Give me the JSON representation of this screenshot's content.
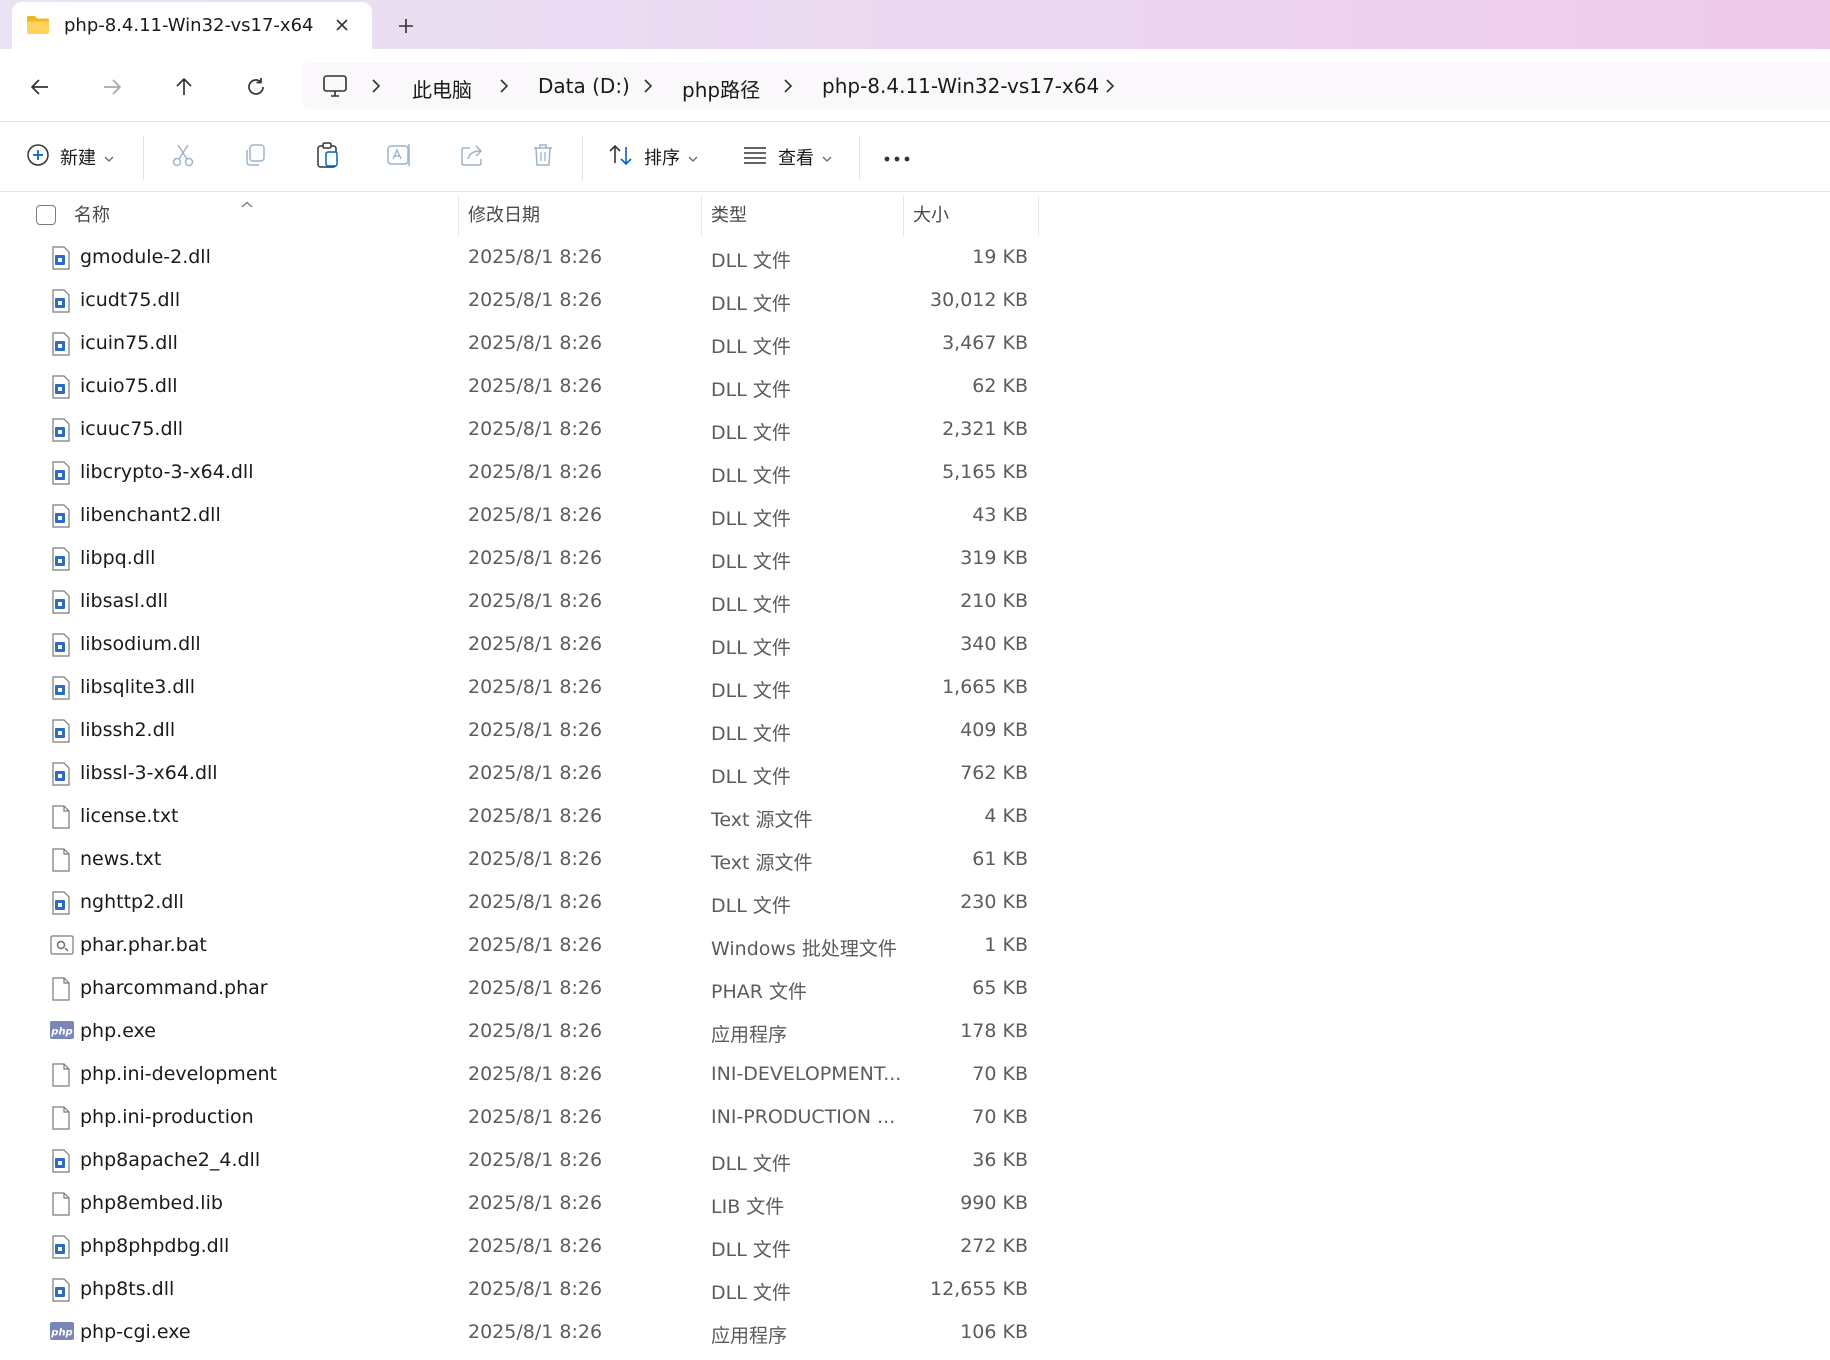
{
  "tab": {
    "title": "php-8.4.11-Win32-vs17-x64",
    "close_icon": "close-icon",
    "new_tab_icon": "plus-icon"
  },
  "nav": {
    "back_icon": "arrow-left-icon",
    "forward_icon": "arrow-right-icon",
    "up_icon": "arrow-up-icon",
    "refresh_icon": "refresh-icon"
  },
  "breadcrumbs": [
    "此电脑",
    "Data (D:)",
    "php路径",
    "php-8.4.11-Win32-vs17-x64"
  ],
  "toolbar": {
    "new_label": "新建",
    "sort_label": "排序",
    "view_label": "查看"
  },
  "columns": {
    "name": "名称",
    "date": "修改日期",
    "type": "类型",
    "size": "大小"
  },
  "files": [
    {
      "name": "gmodule-2.dll",
      "date": "2025/8/1 8:26",
      "type": "DLL 文件",
      "size": "19 KB",
      "icon": "dll"
    },
    {
      "name": "icudt75.dll",
      "date": "2025/8/1 8:26",
      "type": "DLL 文件",
      "size": "30,012 KB",
      "icon": "dll"
    },
    {
      "name": "icuin75.dll",
      "date": "2025/8/1 8:26",
      "type": "DLL 文件",
      "size": "3,467 KB",
      "icon": "dll"
    },
    {
      "name": "icuio75.dll",
      "date": "2025/8/1 8:26",
      "type": "DLL 文件",
      "size": "62 KB",
      "icon": "dll"
    },
    {
      "name": "icuuc75.dll",
      "date": "2025/8/1 8:26",
      "type": "DLL 文件",
      "size": "2,321 KB",
      "icon": "dll"
    },
    {
      "name": "libcrypto-3-x64.dll",
      "date": "2025/8/1 8:26",
      "type": "DLL 文件",
      "size": "5,165 KB",
      "icon": "dll"
    },
    {
      "name": "libenchant2.dll",
      "date": "2025/8/1 8:26",
      "type": "DLL 文件",
      "size": "43 KB",
      "icon": "dll"
    },
    {
      "name": "libpq.dll",
      "date": "2025/8/1 8:26",
      "type": "DLL 文件",
      "size": "319 KB",
      "icon": "dll"
    },
    {
      "name": "libsasl.dll",
      "date": "2025/8/1 8:26",
      "type": "DLL 文件",
      "size": "210 KB",
      "icon": "dll"
    },
    {
      "name": "libsodium.dll",
      "date": "2025/8/1 8:26",
      "type": "DLL 文件",
      "size": "340 KB",
      "icon": "dll"
    },
    {
      "name": "libsqlite3.dll",
      "date": "2025/8/1 8:26",
      "type": "DLL 文件",
      "size": "1,665 KB",
      "icon": "dll"
    },
    {
      "name": "libssh2.dll",
      "date": "2025/8/1 8:26",
      "type": "DLL 文件",
      "size": "409 KB",
      "icon": "dll"
    },
    {
      "name": "libssl-3-x64.dll",
      "date": "2025/8/1 8:26",
      "type": "DLL 文件",
      "size": "762 KB",
      "icon": "dll"
    },
    {
      "name": "license.txt",
      "date": "2025/8/1 8:26",
      "type": "Text 源文件",
      "size": "4 KB",
      "icon": "doc"
    },
    {
      "name": "news.txt",
      "date": "2025/8/1 8:26",
      "type": "Text 源文件",
      "size": "61 KB",
      "icon": "doc"
    },
    {
      "name": "nghttp2.dll",
      "date": "2025/8/1 8:26",
      "type": "DLL 文件",
      "size": "230 KB",
      "icon": "dll"
    },
    {
      "name": "phar.phar.bat",
      "date": "2025/8/1 8:26",
      "type": "Windows 批处理文件",
      "size": "1 KB",
      "icon": "bat"
    },
    {
      "name": "pharcommand.phar",
      "date": "2025/8/1 8:26",
      "type": "PHAR 文件",
      "size": "65 KB",
      "icon": "doc"
    },
    {
      "name": "php.exe",
      "date": "2025/8/1 8:26",
      "type": "应用程序",
      "size": "178 KB",
      "icon": "php"
    },
    {
      "name": "php.ini-development",
      "date": "2025/8/1 8:26",
      "type": "INI-DEVELOPMENT...",
      "size": "70 KB",
      "icon": "doc"
    },
    {
      "name": "php.ini-production",
      "date": "2025/8/1 8:26",
      "type": "INI-PRODUCTION ...",
      "size": "70 KB",
      "icon": "doc"
    },
    {
      "name": "php8apache2_4.dll",
      "date": "2025/8/1 8:26",
      "type": "DLL 文件",
      "size": "36 KB",
      "icon": "dll"
    },
    {
      "name": "php8embed.lib",
      "date": "2025/8/1 8:26",
      "type": "LIB 文件",
      "size": "990 KB",
      "icon": "doc"
    },
    {
      "name": "php8phpdbg.dll",
      "date": "2025/8/1 8:26",
      "type": "DLL 文件",
      "size": "272 KB",
      "icon": "dll"
    },
    {
      "name": "php8ts.dll",
      "date": "2025/8/1 8:26",
      "type": "DLL 文件",
      "size": "12,655 KB",
      "icon": "dll"
    },
    {
      "name": "php-cgi.exe",
      "date": "2025/8/1 8:26",
      "type": "应用程序",
      "size": "106 KB",
      "icon": "php"
    }
  ],
  "colors": {
    "accent": "#0067c0",
    "folder": "#f5c242",
    "php_badge": "#7a86b8"
  }
}
